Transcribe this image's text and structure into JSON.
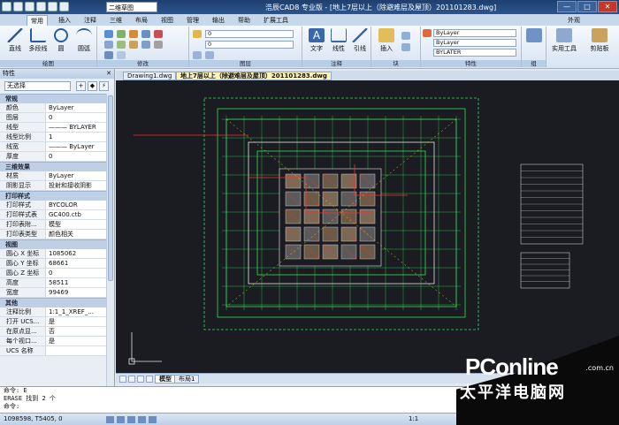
{
  "titlebar": {
    "workspace": "二维草图",
    "title": "浩辰CAD8 专业版 - [地上7层以上（除避难层及屋顶）201101283.dwg]",
    "min": "—",
    "max": "□",
    "close": "✕"
  },
  "menu": {
    "tabs": [
      "常用",
      "插入",
      "注释",
      "三维",
      "布局",
      "视图",
      "管理",
      "输出",
      "帮助",
      "扩展工具"
    ],
    "right": "外观"
  },
  "ribbon": {
    "draw": {
      "label": "绘图",
      "btn1": "直线",
      "btn2": "多段线",
      "btn3": "圆",
      "btn4": "圆弧"
    },
    "modify": {
      "label": "修改"
    },
    "layer": {
      "label": "图层",
      "combo1": "0",
      "combo2": "0"
    },
    "annot": {
      "label": "注释",
      "btn1": "文字",
      "btn2": "线性",
      "btn3": "引线"
    },
    "block": {
      "label": "块",
      "btn1": "插入"
    },
    "prop": {
      "label": "特性",
      "c1": "ByLayer",
      "c2": "ByLayer",
      "c3": "BYLATER"
    },
    "group": {
      "label": "组"
    },
    "tools": {
      "btn1": "实用工具",
      "btn2": "剪贴板"
    }
  },
  "panel": {
    "title": "特性",
    "close": "✕",
    "selection": "无选择",
    "sections": [
      {
        "name": "常规",
        "rows": [
          [
            "颜色",
            "ByLayer"
          ],
          [
            "图层",
            "0"
          ],
          [
            "线型",
            "——— BYLAYER"
          ],
          [
            "线型比例",
            "1"
          ],
          [
            "线宽",
            "——— ByLayer"
          ],
          [
            "厚度",
            "0"
          ]
        ]
      },
      {
        "name": "三维效果",
        "rows": [
          [
            "材质",
            "ByLayer"
          ],
          [
            "阴影显示",
            "投射和接收阴影"
          ]
        ]
      },
      {
        "name": "打印样式",
        "rows": [
          [
            "打印样式",
            "BYCOLOR"
          ],
          [
            "打印样式表",
            "GC400.ctb"
          ],
          [
            "打印表附...",
            "模型"
          ],
          [
            "打印表类型",
            "颜色相关"
          ]
        ]
      },
      {
        "name": "视图",
        "rows": [
          [
            "圆心 X 坐标",
            "1085062"
          ],
          [
            "圆心 Y 坐标",
            "68661"
          ],
          [
            "圆心 Z 坐标",
            "0"
          ],
          [
            "高度",
            "58511"
          ],
          [
            "宽度",
            "99469"
          ]
        ]
      },
      {
        "name": "其他",
        "rows": [
          [
            "注释比例",
            "1:1_1_XREF_..."
          ],
          [
            "打开 UCS...",
            "是"
          ],
          [
            "在原点显...",
            "否"
          ],
          [
            "每个视口...",
            "是"
          ],
          [
            "UCS 名称",
            ""
          ]
        ]
      }
    ]
  },
  "doctabs": [
    "Drawing1.dwg",
    "地上7层以上（除避难层及屋顶）201101283.dwg"
  ],
  "layouttabs": [
    "模型",
    "布局1"
  ],
  "command": [
    "命令: E",
    "ERASE 找到 2 个",
    "命令:"
  ],
  "status": {
    "coords": "1098598, T5405, 0",
    "scale": "1:1"
  },
  "watermark": {
    "brand": "PConline",
    "domain": ".com.cn",
    "cn": "太平洋电脑网"
  },
  "colors": {
    "canvas": "#1b1b22",
    "plan_green": "#33e05a",
    "plan_red": "#ff3030",
    "plan_white": "#e8e8e8",
    "plan_yellow": "#e6e600"
  }
}
